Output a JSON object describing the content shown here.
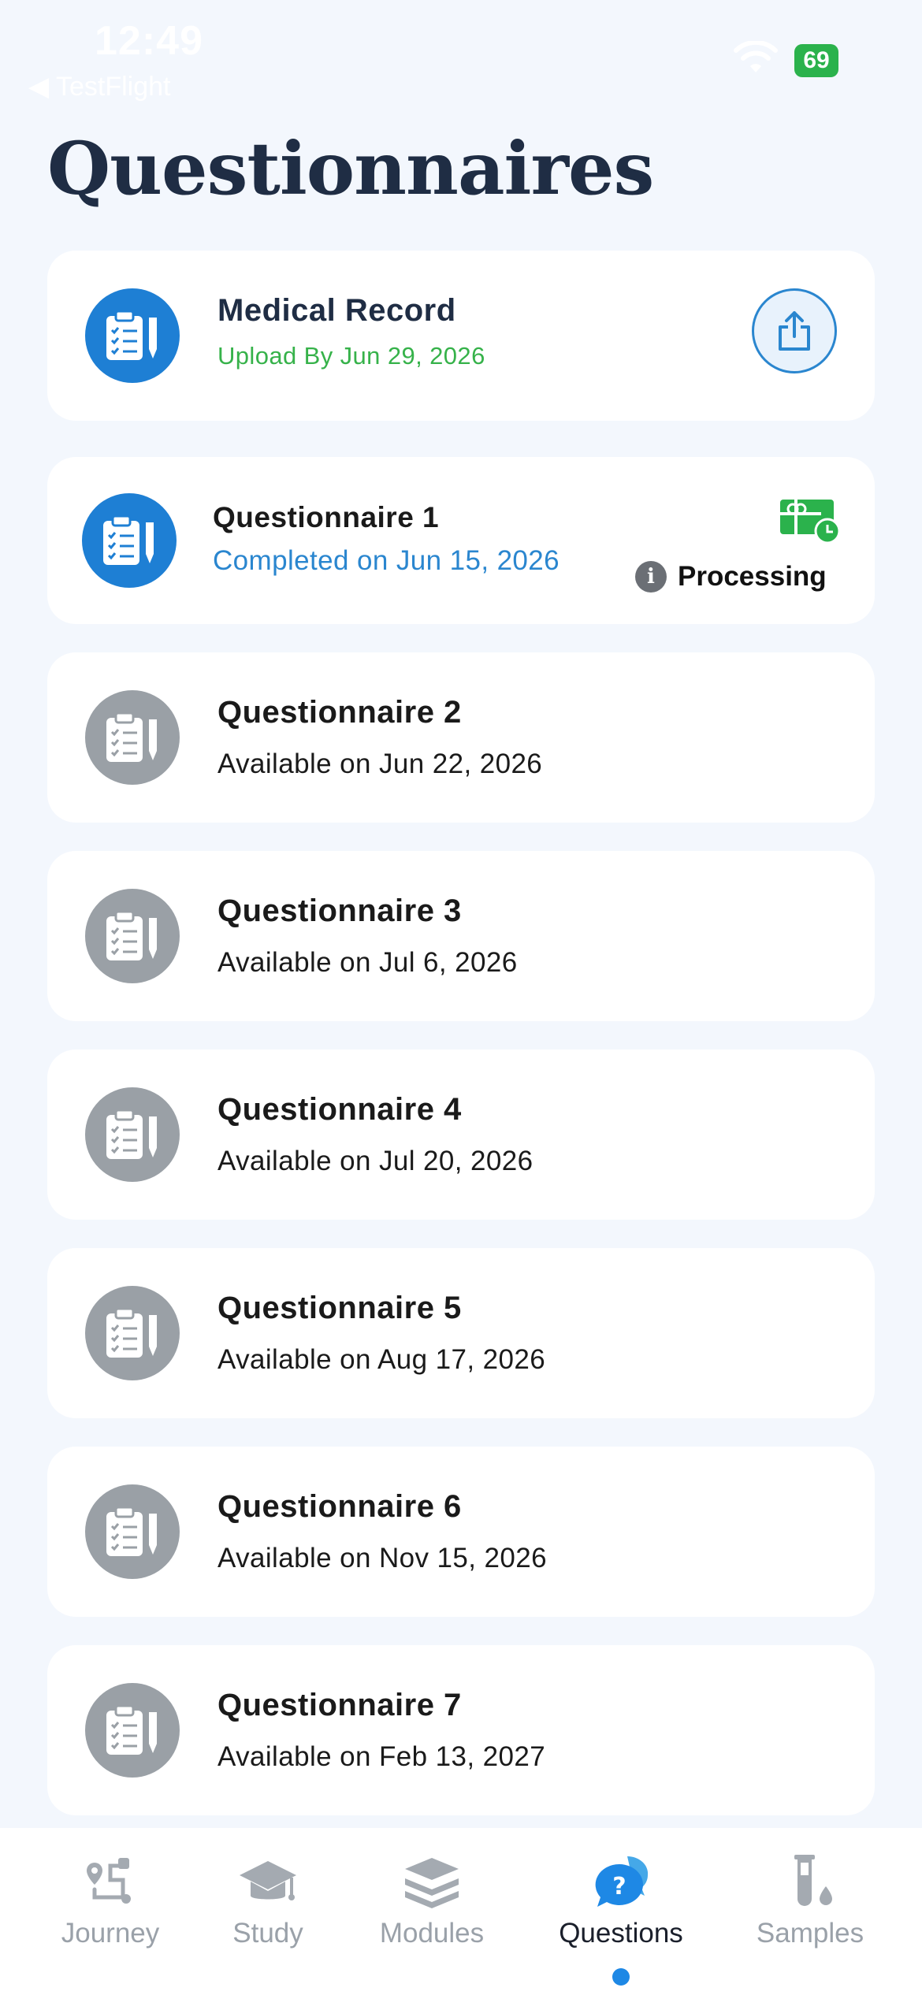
{
  "status_bar": {
    "time": "12:49",
    "back_label": "◀ TestFlight",
    "battery": "69"
  },
  "page": {
    "title": "Questionnaires"
  },
  "colors": {
    "accent_blue": "#1e7fd4",
    "success_green": "#36b24a",
    "inactive_gray": "#9aa0a6",
    "background": "#f3f7fd"
  },
  "medical_record": {
    "title": "Medical Record",
    "subtitle": "Upload By Jun 29, 2026",
    "icon": "clipboard-icon",
    "action_icon": "share-upload-icon"
  },
  "questionnaires": [
    {
      "title": "Questionnaire 1",
      "subtitle": "Completed on Jun 15, 2026",
      "status": "Processing",
      "status_icon": "gift-card-clock-icon"
    },
    {
      "title": "Questionnaire 2",
      "subtitle": "Available on Jun 22, 2026"
    },
    {
      "title": "Questionnaire 3",
      "subtitle": "Available on Jul 6, 2026"
    },
    {
      "title": "Questionnaire 4",
      "subtitle": "Available on Jul 20, 2026"
    },
    {
      "title": "Questionnaire 5",
      "subtitle": "Available on Aug 17, 2026"
    },
    {
      "title": "Questionnaire 6",
      "subtitle": "Available on Nov 15, 2026"
    },
    {
      "title": "Questionnaire 7",
      "subtitle": "Available on Feb 13, 2027"
    }
  ],
  "tab_bar": {
    "tabs": [
      {
        "label": "Journey",
        "icon": "route-icon"
      },
      {
        "label": "Study",
        "icon": "graduation-cap-icon"
      },
      {
        "label": "Modules",
        "icon": "stack-icon"
      },
      {
        "label": "Questions",
        "icon": "question-bubble-icon",
        "active": true
      },
      {
        "label": "Samples",
        "icon": "test-tube-icon"
      }
    ]
  }
}
